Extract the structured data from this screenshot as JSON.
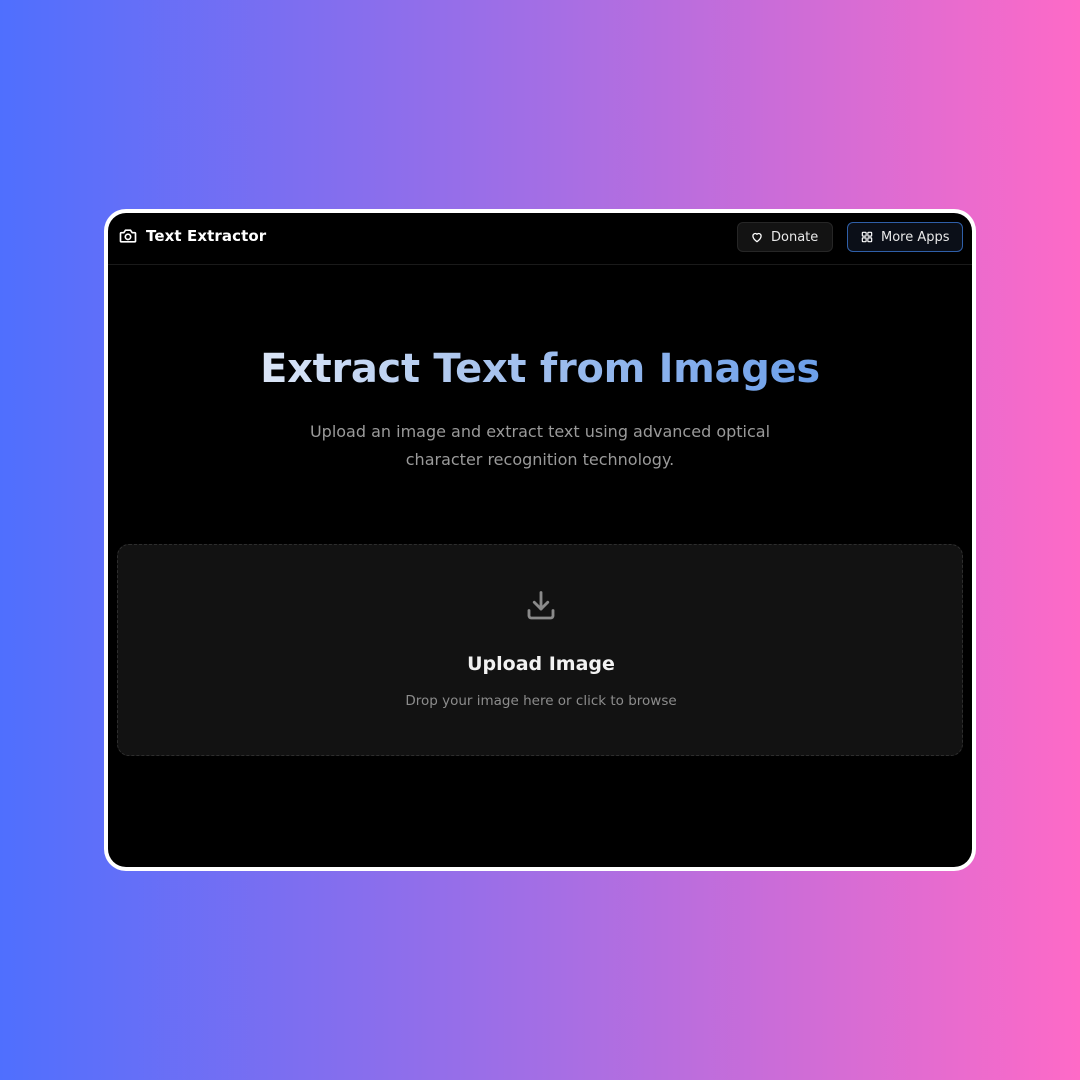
{
  "app": {
    "title": "Text Extractor",
    "icon": "camera-icon"
  },
  "nav": {
    "donate_label": "Donate",
    "donate_icon": "heart-icon",
    "more_apps_label": "More Apps",
    "more_apps_icon": "grid-icon"
  },
  "hero": {
    "title": "Extract Text from Images",
    "subtitle": "Upload an image and extract text using advanced optical character recognition technology."
  },
  "upload": {
    "icon": "download-tray-icon",
    "title": "Upload Image",
    "hint": "Drop your image here or click to browse"
  },
  "colors": {
    "background_gradient_start": "#4f6ffe",
    "background_gradient_mid": "#a36ee5",
    "background_gradient_end": "#fe6ac7",
    "window_bg": "#000000",
    "dropzone_bg": "#121212",
    "more_apps_border": "#2f5fa8",
    "title_gradient_start": "#dbe6f7",
    "title_gradient_end": "#6c9fea"
  }
}
